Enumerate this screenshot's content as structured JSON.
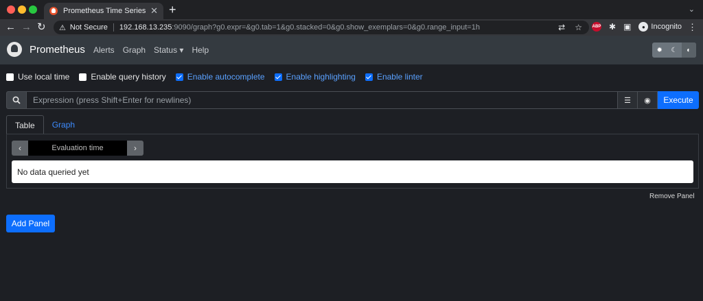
{
  "browser": {
    "tab_title": "Prometheus Time Series Collec",
    "tab_close": "✕",
    "new_tab": "+",
    "security_label": "Not Secure",
    "url_host": "192.168.13.235",
    "url_rest": ":9090/graph?g0.expr=&g0.tab=1&g0.stacked=0&g0.show_exemplars=0&g0.range_input=1h",
    "abp_badge": "ABP",
    "incognito_label": "Incognito"
  },
  "navbar": {
    "brand": "Prometheus",
    "links": [
      "Alerts",
      "Graph",
      "Status ▾",
      "Help"
    ]
  },
  "options": [
    {
      "label": "Use local time",
      "checked": false
    },
    {
      "label": "Enable query history",
      "checked": false
    },
    {
      "label": "Enable autocomplete",
      "checked": true
    },
    {
      "label": "Enable highlighting",
      "checked": true
    },
    {
      "label": "Enable linter",
      "checked": true
    }
  ],
  "expression": {
    "placeholder": "Expression (press Shift+Enter for newlines)",
    "value": "",
    "execute_label": "Execute"
  },
  "panel": {
    "tabs": [
      "Table",
      "Graph"
    ],
    "active_tab": "Table",
    "eval_placeholder": "Evaluation time",
    "no_data": "No data queried yet",
    "remove_label": "Remove Panel"
  },
  "add_panel_label": "Add Panel",
  "colors": {
    "accent": "#0d6efd",
    "navbar": "#343a40",
    "background": "#1d1f24"
  },
  "icons": {
    "search": "search-icon",
    "format": "format-icon",
    "metrics_explorer": "globe-icon",
    "theme_light": "sun-icon",
    "theme_dark": "moon-icon",
    "theme_auto": "contrast-icon"
  }
}
